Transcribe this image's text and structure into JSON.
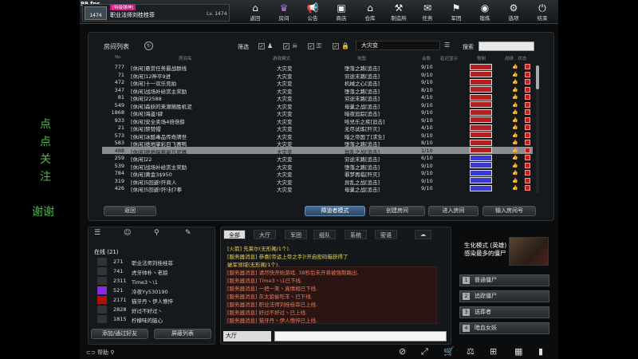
{
  "fps": "99 fps",
  "player": {
    "vip_tag": "[特级弹神]",
    "name": "职业法师刘桂桂菲",
    "level": "Lv. 1474",
    "rank_value": "1474"
  },
  "topnav": [
    {
      "label": "返回",
      "icon": "home-icon",
      "glyph": "⌂"
    },
    {
      "label": "房间",
      "icon": "crown-icon",
      "glyph": "♛"
    },
    {
      "label": "公告",
      "icon": "megaphone-icon",
      "glyph": "📢"
    },
    {
      "label": "商店",
      "icon": "shop-icon",
      "glyph": "▣"
    },
    {
      "label": "仓库",
      "icon": "warehouse-icon",
      "glyph": "⌂"
    },
    {
      "label": "制造所",
      "icon": "factory-icon",
      "glyph": "⚒"
    },
    {
      "label": "任务",
      "icon": "task-icon",
      "glyph": "✉"
    },
    {
      "label": "军团",
      "icon": "legion-icon",
      "glyph": "⚑"
    },
    {
      "label": "锻炼",
      "icon": "training-icon",
      "glyph": "◉"
    },
    {
      "label": "选项",
      "icon": "gear-icon",
      "glyph": "⚙"
    },
    {
      "label": "结束",
      "icon": "power-icon",
      "glyph": "⏻"
    }
  ],
  "room_panel": {
    "title": "房间列表",
    "filter_label": "筛选",
    "mode_value": "大灾变",
    "search_label": "搜索",
    "columns": [
      "No",
      "房间名",
      "游戏模式",
      "地图",
      "会数",
      "延迟显示",
      "限制",
      "战绩 . 状态"
    ],
    "rows": [
      {
        "no": "777",
        "name": "[休闲]悬赏任务最战群线",
        "mode": "大灾变",
        "map": "堕落之路[追击]",
        "players": "9/10",
        "ping": "#b52020"
      },
      {
        "no": "71",
        "name": "[休闲]12神平9进",
        "mode": "大灾变",
        "map": "穷途末路[追击]",
        "players": "9/10",
        "ping": "#b52020"
      },
      {
        "no": "472",
        "name": "[休闲]十一欢乐竞拍",
        "mode": "大灾变",
        "map": "机械之心[追击]",
        "players": "9/10",
        "ping": "#b52020"
      },
      {
        "no": "347",
        "name": "[休闲]战场补给赏主奖励",
        "mode": "大灾变",
        "map": "堕落之路[追击]",
        "players": "8/10",
        "ping": "#b52020"
      },
      {
        "no": "81",
        "name": "[休闲]22588",
        "mode": "大灾变",
        "map": "穷途末路[追击]",
        "players": "4/10",
        "ping": "#b52020"
      },
      {
        "no": "549",
        "name": "[休闲]森妖的来源随胜机泥",
        "mode": "大灾变",
        "map": "母巢之战[追击]",
        "players": "9/10",
        "ping": "#b52020"
      },
      {
        "no": "1868",
        "name": "[休闲]海盗!肆",
        "mode": "大灾变",
        "map": "暗夜追踪[追击]",
        "players": "9/10",
        "ping": "#b52020"
      },
      {
        "no": "933",
        "name": "[休闲]安全卖场4倍倍薛",
        "mode": "大灾变",
        "map": "哈兒乐之疾[追击]",
        "players": "9/10",
        "ping": "#b52020"
      },
      {
        "no": "21",
        "name": "[休闲]禁赞帽",
        "mode": "大灾变",
        "map": "无尽试炼[歼灭]",
        "players": "4/10",
        "ping": "#b52020"
      },
      {
        "no": "573",
        "name": "[休闲]冰酷毒品传奇牌世",
        "mode": "大灾变",
        "map": "暗之帝国了[求生]",
        "players": "9/10",
        "ping": "#b52020"
      },
      {
        "no": "583",
        "name": "[休闲]绝地掌彩目飞赛鸭",
        "mode": "大灾变",
        "map": "堕落之路[追击]",
        "players": "8/10",
        "ping": "#b52020"
      },
      {
        "no": "488",
        "name": "[休闲]绝地探索副凡武器",
        "mode": "大灾变",
        "map": "异乱之战[追击]",
        "players": "1/10",
        "ping": "#b52020",
        "selected": true
      },
      {
        "no": "259",
        "name": "[休闲]22",
        "mode": "大灾变",
        "map": "穷途末路[追击]",
        "players": "6/10",
        "ping": "#3a3ad0"
      },
      {
        "no": "539",
        "name": "[休闲]战场补给赏主奖励",
        "mode": "大灾变",
        "map": "堕落之路[追击]",
        "players": "9/10",
        "ping": "#3a3ad0"
      },
      {
        "no": "784",
        "name": "[休闲]黄金3$950",
        "mode": "大灾变",
        "map": "罪梦再临[歼灭]",
        "players": "9/10",
        "ping": "#3a3ad0"
      },
      {
        "no": "319",
        "name": "[休闲]5回避!歼商人",
        "mode": "大灾变",
        "map": "异乱之战[追击]",
        "players": "9/10",
        "ping": "#3a3ad0"
      },
      {
        "no": "426",
        "name": "[休闲]5回避!歼!封7拳",
        "mode": "大灾变",
        "map": "母巢之战[追击]",
        "players": "9/10",
        "ping": "#3a3ad0"
      }
    ],
    "buttons": {
      "back": "返回",
      "observer": "障道者模式",
      "create": "创建房间",
      "enter": "进入房间",
      "enter_no": "输入房间号"
    }
  },
  "side_text": {
    "line1": "点",
    "line2": "点",
    "line3": "关",
    "line4": "注",
    "line5": "谢谢"
  },
  "friends": {
    "online_label": "在线 (21)",
    "rows": [
      {
        "level": "271",
        "name": "职业法师刘桂桂菲"
      },
      {
        "level": "741",
        "name": "虎牙帅朴丶老狼"
      },
      {
        "level": "2311",
        "name": "Time3丶\\1"
      },
      {
        "level": "521",
        "name": "冷夜Yy530190"
      },
      {
        "level": "2171",
        "name": "猫牙丹丶伊人憔悴"
      },
      {
        "level": "2828",
        "name": "好过不好过丶"
      },
      {
        "level": "1815",
        "name": "柠檬味的脑心"
      }
    ],
    "add_button": "添加/通过好友",
    "block_button": "屏蔽列表"
  },
  "chat": {
    "tabs": [
      "全部",
      "大厅",
      "军团",
      "组队",
      "系统",
      "密语"
    ],
    "lines": [
      {
        "prefix": "[火箭]",
        "text": "先莱尔(无形阁/1个).",
        "cls": "yel"
      },
      {
        "prefix": "[服务器消息]",
        "text": "恭喜[帝运上帝之手]!开启密码箱获得了",
        "cls": "yel"
      },
      {
        "prefix": "",
        "text": "破军领域(无形阁/1个).",
        "cls": "yel"
      },
      {
        "prefix": "[服务器消息]",
        "text": "请尽快开始游戏, 38秒后未开将被强制踢出.",
        "cls": "sys"
      },
      {
        "prefix": "[服务器消息]",
        "text": "Time3丶\\1已下线.",
        "cls": "sys"
      },
      {
        "prefix": "[服务器消息]",
        "text": "一把一笑丶真情相已下线.",
        "cls": "sys"
      },
      {
        "prefix": "[服务器消息]",
        "text": "灰太狼偷吃羊丶已下线.",
        "cls": "sys"
      },
      {
        "prefix": "[服务器消息]",
        "text": "职业法师刘桂桂菲已上线.",
        "cls": "sys"
      },
      {
        "prefix": "[服务器消息]",
        "text": "好过不好过丶已上线.",
        "cls": "sys"
      },
      {
        "prefix": "[服务器消息]",
        "text": "猫牙丹丶伊人憔悴已上线.",
        "cls": "sys"
      }
    ],
    "channel": "大厅"
  },
  "mode_box": {
    "title1": "生化模式 (英雄)",
    "title2": "感染最多的僵尸",
    "buttons": [
      "普通僵尸",
      "追踪僵尸",
      "送葬者",
      "暗血女妖"
    ]
  },
  "bottom_help": "帮助"
}
